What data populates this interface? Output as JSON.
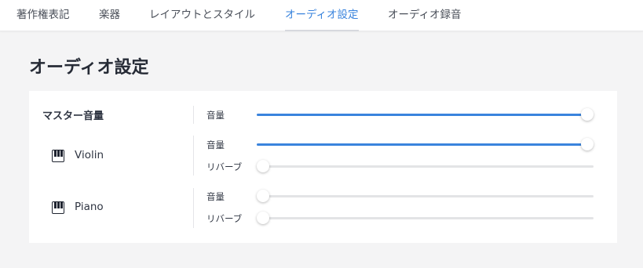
{
  "tabs": [
    {
      "label": "著作権表記",
      "active": false
    },
    {
      "label": "楽器",
      "active": false
    },
    {
      "label": "レイアウトとスタイル",
      "active": false
    },
    {
      "label": "オーディオ設定",
      "active": true
    },
    {
      "label": "オーディオ録音",
      "active": false
    }
  ],
  "page": {
    "title": "オーディオ設定"
  },
  "master": {
    "label": "マスター音量",
    "controls": [
      {
        "label": "音量",
        "value": 1.0
      }
    ]
  },
  "instruments": [
    {
      "name": "Violin",
      "icon": "piano-keys-icon",
      "controls": [
        {
          "label": "音量",
          "value": 1.0
        },
        {
          "label": "リバーブ",
          "value": 0.0
        }
      ]
    },
    {
      "name": "Piano",
      "icon": "piano-keys-icon",
      "controls": [
        {
          "label": "音量",
          "value": 0.0
        },
        {
          "label": "リバーブ",
          "value": 0.0
        }
      ]
    }
  ],
  "colors": {
    "accent": "#3a84dd",
    "track": "#e3e4e6",
    "background": "#f4f4f5"
  }
}
